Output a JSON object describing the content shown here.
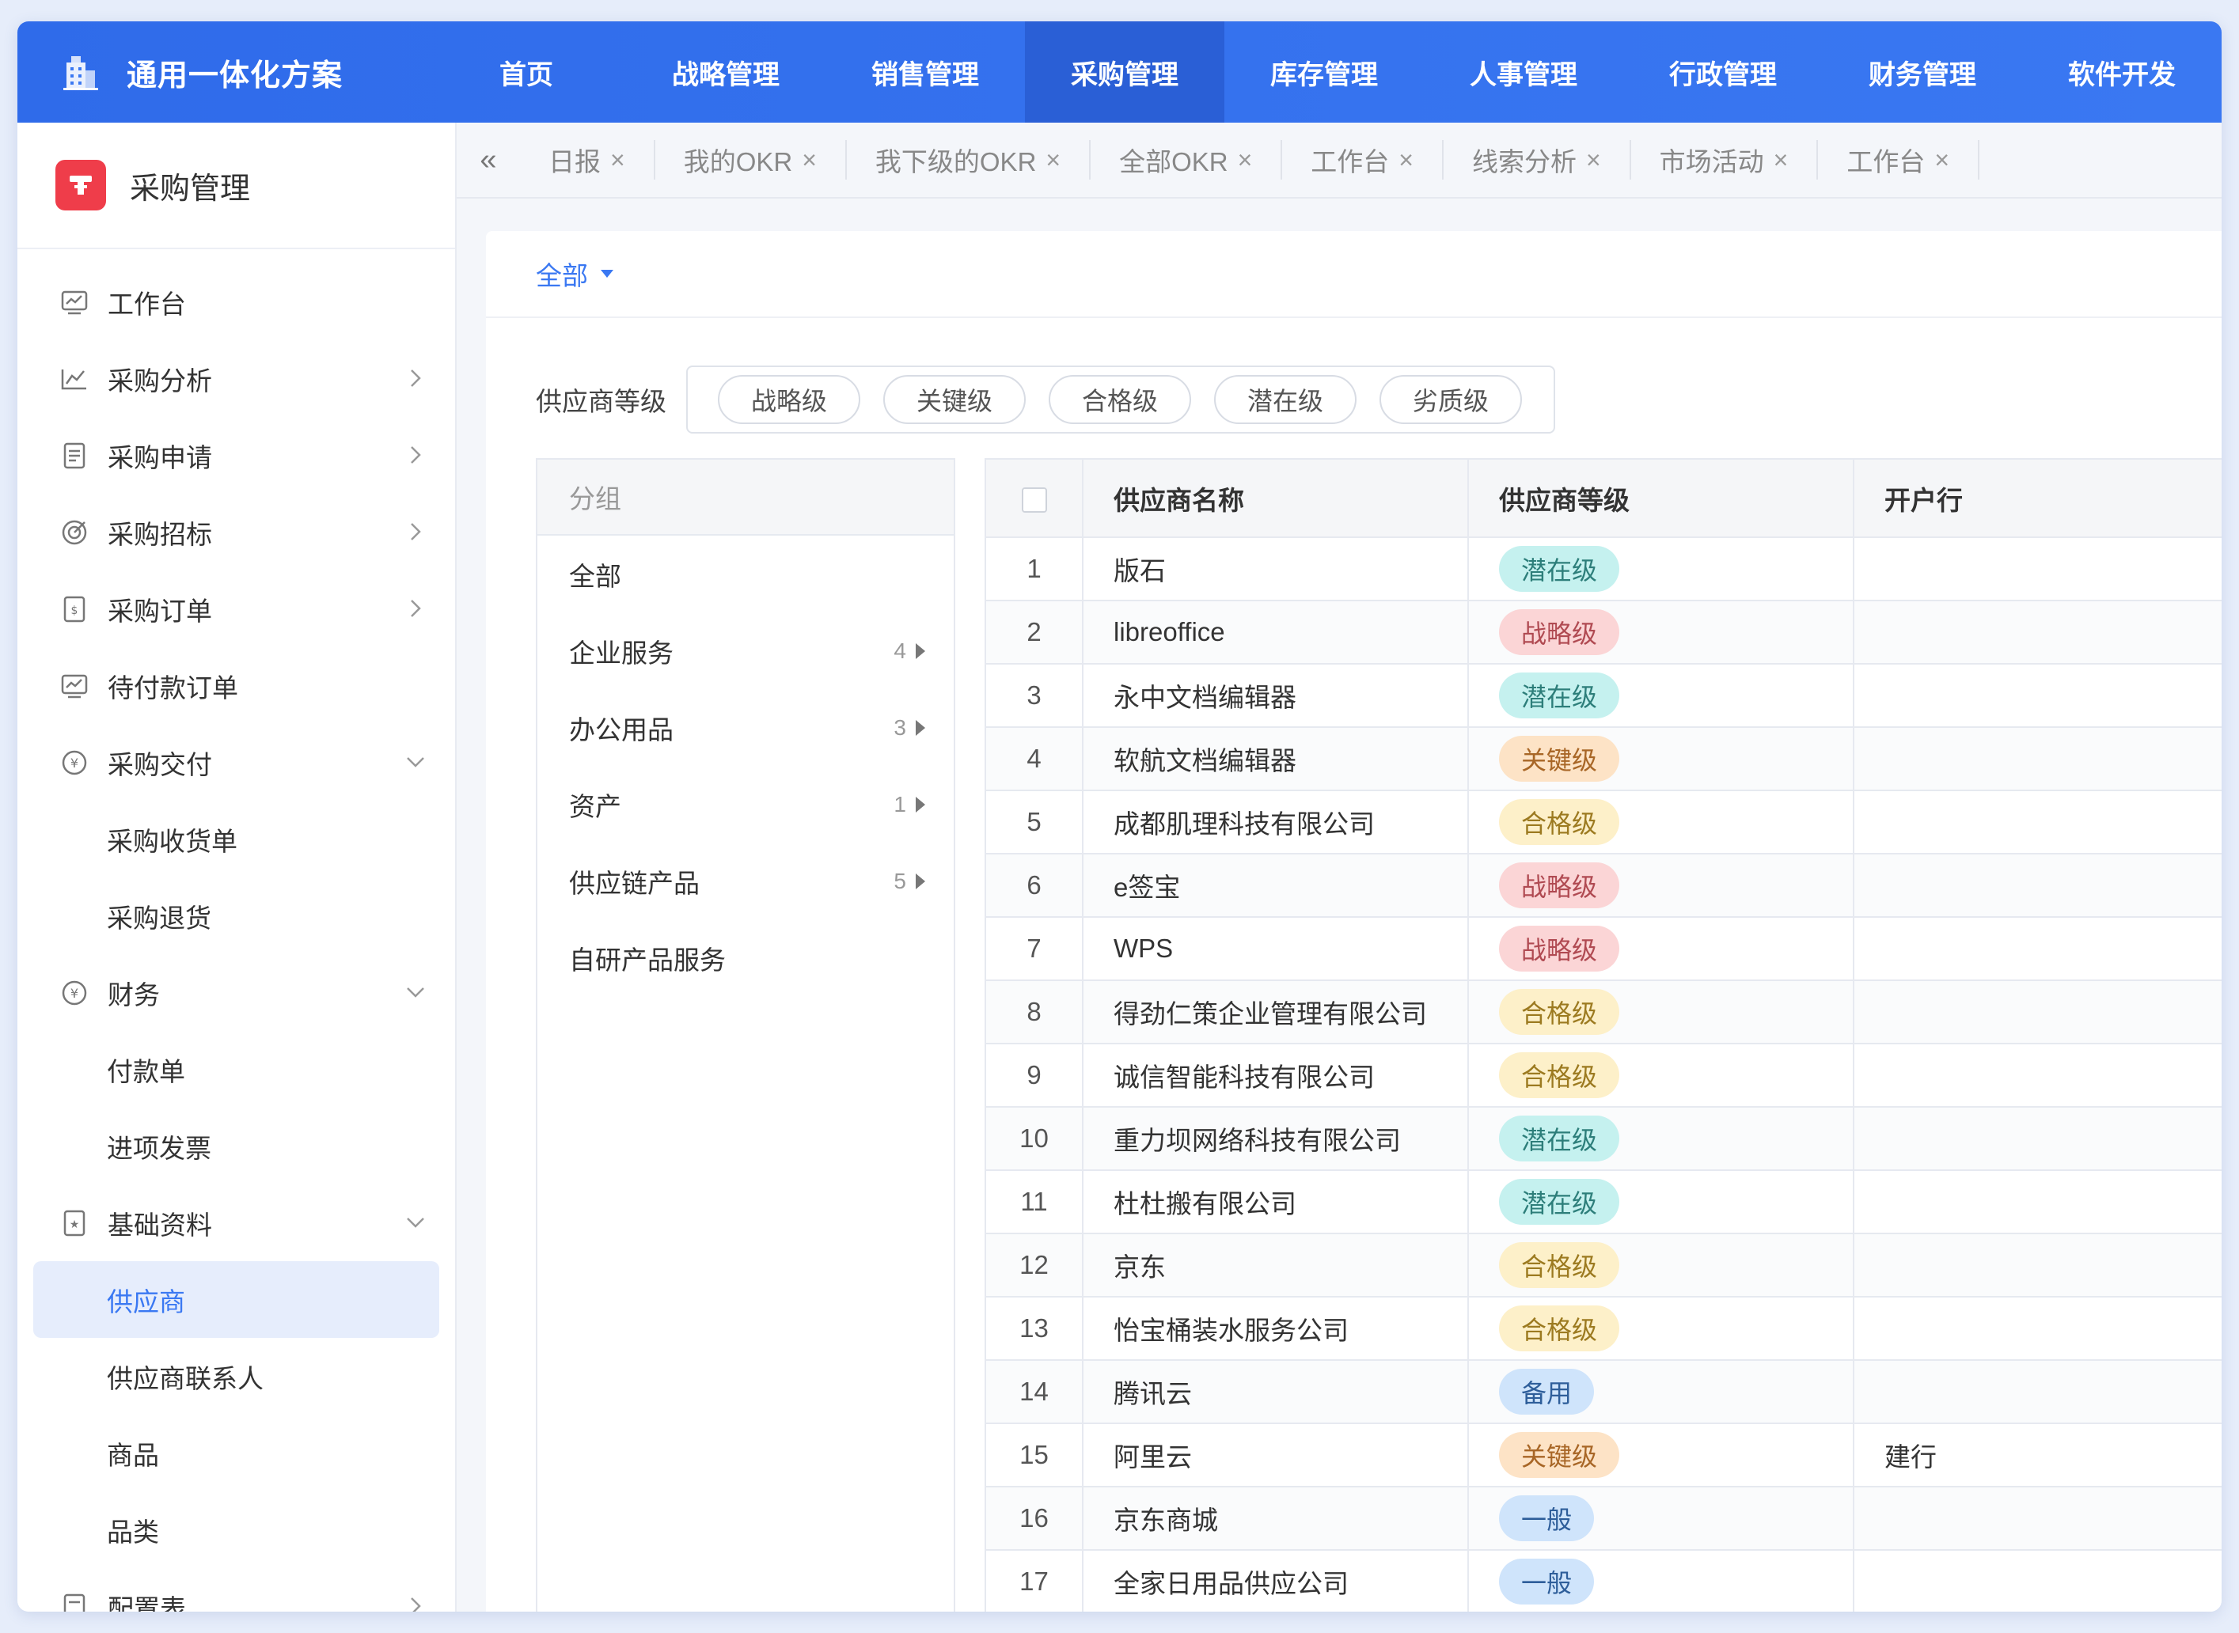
{
  "app": {
    "title": "通用一体化方案",
    "nav": [
      "首页",
      "战略管理",
      "销售管理",
      "采购管理",
      "库存管理",
      "人事管理",
      "行政管理",
      "财务管理",
      "软件开发"
    ],
    "active_nav": 3
  },
  "sidebar": {
    "title": "采购管理",
    "items": [
      {
        "label": "工作台",
        "icon": "dashboard-icon",
        "chevron": "none",
        "type": "top"
      },
      {
        "label": "采购分析",
        "icon": "analysis-icon",
        "chevron": "right",
        "type": "top"
      },
      {
        "label": "采购申请",
        "icon": "request-icon",
        "chevron": "right",
        "type": "top"
      },
      {
        "label": "采购招标",
        "icon": "bid-icon",
        "chevron": "right",
        "type": "top"
      },
      {
        "label": "采购订单",
        "icon": "order-icon",
        "chevron": "right",
        "type": "top"
      },
      {
        "label": "待付款订单",
        "icon": "payment-pending-icon",
        "chevron": "none",
        "type": "top"
      },
      {
        "label": "采购交付",
        "icon": "delivery-icon",
        "chevron": "down",
        "type": "top"
      },
      {
        "label": "采购收货单",
        "type": "sub"
      },
      {
        "label": "采购退货",
        "type": "sub"
      },
      {
        "label": "财务",
        "icon": "finance-icon",
        "chevron": "down",
        "type": "top"
      },
      {
        "label": "付款单",
        "type": "sub"
      },
      {
        "label": "进项发票",
        "type": "sub"
      },
      {
        "label": "基础资料",
        "icon": "basic-data-icon",
        "chevron": "down",
        "type": "top"
      },
      {
        "label": "供应商",
        "type": "sub",
        "active": true
      },
      {
        "label": "供应商联系人",
        "type": "sub"
      },
      {
        "label": "商品",
        "type": "sub"
      },
      {
        "label": "品类",
        "type": "sub"
      },
      {
        "label": "配置表",
        "icon": "config-icon",
        "chevron": "right",
        "type": "top"
      }
    ]
  },
  "tabs": [
    "日报",
    "我的OKR",
    "我下级的OKR",
    "全部OKR",
    "工作台",
    "线索分析",
    "市场活动",
    "工作台"
  ],
  "filter": {
    "scope": "全部",
    "grade_label": "供应商等级",
    "grades": [
      "战略级",
      "关键级",
      "合格级",
      "潜在级",
      "劣质级"
    ]
  },
  "groups": {
    "header": "分组",
    "items": [
      {
        "label": "全部",
        "count": ""
      },
      {
        "label": "企业服务",
        "count": "4"
      },
      {
        "label": "办公用品",
        "count": "3"
      },
      {
        "label": "资产",
        "count": "1"
      },
      {
        "label": "供应链产品",
        "count": "5"
      },
      {
        "label": "自研产品服务",
        "count": ""
      }
    ]
  },
  "table": {
    "columns": [
      "供应商名称",
      "供应商等级",
      "开户行"
    ],
    "rows": [
      {
        "idx": "1",
        "name": "版石",
        "grade": "潜在级",
        "tone": "qz",
        "bank": ""
      },
      {
        "idx": "2",
        "name": "libreoffice",
        "grade": "战略级",
        "tone": "zl",
        "bank": ""
      },
      {
        "idx": "3",
        "name": "永中文档编辑器",
        "grade": "潜在级",
        "tone": "qz",
        "bank": ""
      },
      {
        "idx": "4",
        "name": "软航文档编辑器",
        "grade": "关键级",
        "tone": "gj",
        "bank": ""
      },
      {
        "idx": "5",
        "name": "成都肌理科技有限公司",
        "grade": "合格级",
        "tone": "hg",
        "bank": ""
      },
      {
        "idx": "6",
        "name": "e签宝",
        "grade": "战略级",
        "tone": "zl",
        "bank": ""
      },
      {
        "idx": "7",
        "name": "WPS",
        "grade": "战略级",
        "tone": "zl",
        "bank": ""
      },
      {
        "idx": "8",
        "name": "得劲仁策企业管理有限公司",
        "grade": "合格级",
        "tone": "hg",
        "bank": ""
      },
      {
        "idx": "9",
        "name": "诚信智能科技有限公司",
        "grade": "合格级",
        "tone": "hg",
        "bank": ""
      },
      {
        "idx": "10",
        "name": "重力坝网络科技有限公司",
        "grade": "潜在级",
        "tone": "qz",
        "bank": ""
      },
      {
        "idx": "11",
        "name": "杜杜搬有限公司",
        "grade": "潜在级",
        "tone": "qz",
        "bank": ""
      },
      {
        "idx": "12",
        "name": "京东",
        "grade": "合格级",
        "tone": "hg",
        "bank": ""
      },
      {
        "idx": "13",
        "name": "怡宝桶装水服务公司",
        "grade": "合格级",
        "tone": "hg",
        "bank": ""
      },
      {
        "idx": "14",
        "name": "腾讯云",
        "grade": "备用",
        "tone": "by",
        "bank": ""
      },
      {
        "idx": "15",
        "name": "阿里云",
        "grade": "关键级",
        "tone": "gj",
        "bank": "建行"
      },
      {
        "idx": "16",
        "name": "京东商城",
        "grade": "一般",
        "tone": "yb",
        "bank": ""
      },
      {
        "idx": "17",
        "name": "全家日用品供应公司",
        "grade": "一般",
        "tone": "yb",
        "bank": ""
      }
    ]
  },
  "colors": {
    "primary": "#3a78f2",
    "nav_active": "#2a5fd6",
    "brand_red": "#ef3d4a"
  }
}
